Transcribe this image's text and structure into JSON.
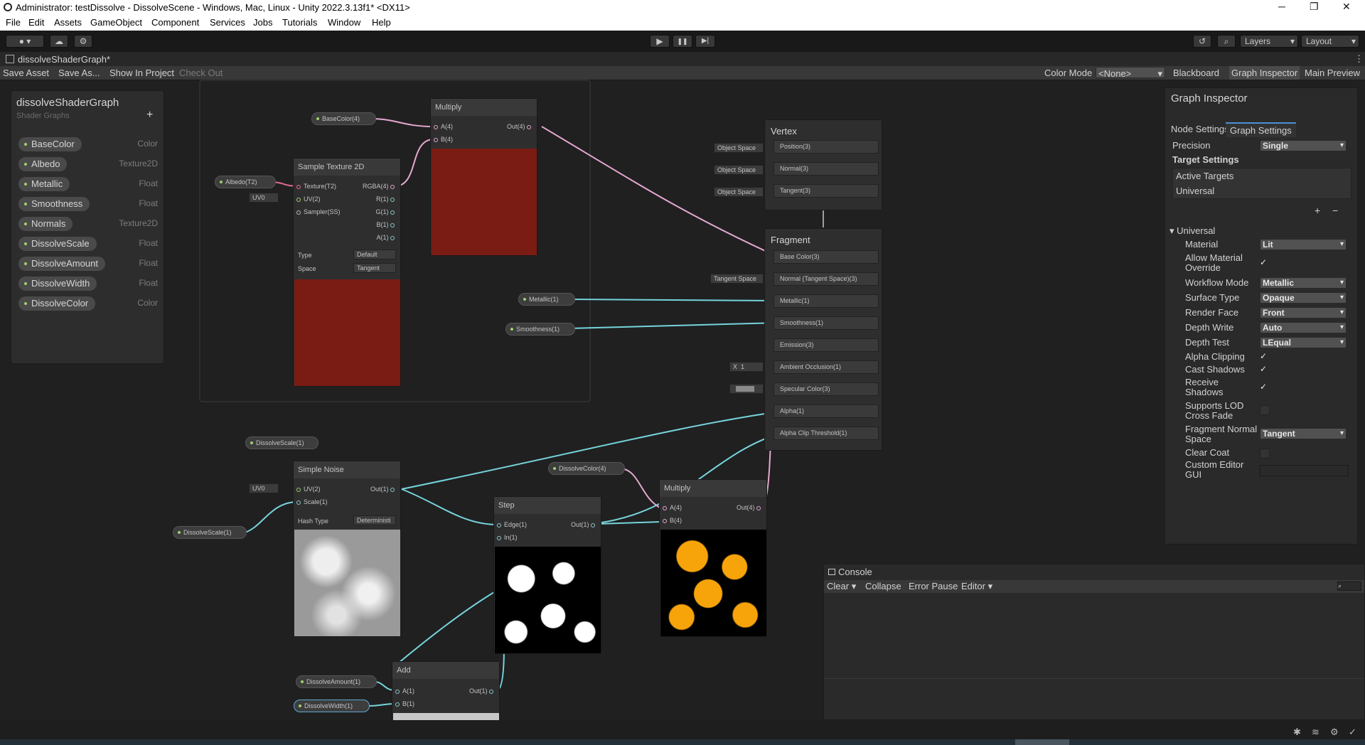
{
  "window": {
    "title": "Administrator: testDissolve - DissolveScene - Windows, Mac, Linux - Unity 2022.3.13f1* <DX11>",
    "controls": [
      "─",
      "❐",
      "✕"
    ]
  },
  "menu": [
    "File",
    "Edit",
    "Assets",
    "GameObject",
    "Component",
    "Services",
    "Jobs",
    "Tutorials",
    "Window",
    "Help"
  ],
  "toolbar": {
    "play_icon": "▶",
    "pause_icon": "❚❚",
    "step_icon": "▶|",
    "layers_label": "Layers",
    "layout_label": "Layout"
  },
  "tab": {
    "label": "dissolveShaderGraph*"
  },
  "graph_toolbar": {
    "save_asset": "Save Asset",
    "save_as": "Save As...",
    "show_in_project": "Show In Project",
    "check_out": "Check Out",
    "color_mode_label": "Color Mode",
    "color_mode_value": "<None>",
    "blackboard": "Blackboard",
    "graph_inspector": "Graph Inspector",
    "main_preview": "Main Preview"
  },
  "blackboard": {
    "title": "dissolveShaderGraph",
    "subtitle": "Shader Graphs",
    "add_label": "+",
    "properties": [
      {
        "name": "BaseColor",
        "type": "Color"
      },
      {
        "name": "Albedo",
        "type": "Texture2D"
      },
      {
        "name": "Metallic",
        "type": "Float"
      },
      {
        "name": "Smoothness",
        "type": "Float"
      },
      {
        "name": "Normals",
        "type": "Texture2D"
      },
      {
        "name": "DissolveScale",
        "type": "Float"
      },
      {
        "name": "DissolveAmount",
        "type": "Float"
      },
      {
        "name": "DissolveWidth",
        "type": "Float"
      },
      {
        "name": "DissolveColor",
        "type": "Color"
      }
    ]
  },
  "nodes": {
    "multiply1": {
      "title": "Multiply",
      "a": "A(4)",
      "b": "B(4)",
      "out": "Out(4)"
    },
    "sample_tex": {
      "title": "Sample Texture 2D",
      "inputs": [
        "Texture(T2)",
        "UV(2)",
        "Sampler(SS)"
      ],
      "outputs": [
        "RGBA(4)",
        "R(1)",
        "G(1)",
        "B(1)",
        "A(1)"
      ],
      "type_label": "Type",
      "type_value": "Default",
      "space_label": "Space",
      "space_value": "Tangent"
    },
    "vertex": {
      "title": "Vertex",
      "slots": [
        "Position(3)",
        "Normal(3)",
        "Tangent(3)"
      ],
      "chip": "Object Space"
    },
    "fragment": {
      "title": "Fragment",
      "slots": [
        "Base Color(3)",
        "Normal (Tangent Space)(3)",
        "Metallic(1)",
        "Smoothness(1)",
        "Emission(3)",
        "Ambient Occlusion(1)",
        "Specular Color(3)",
        "Alpha(1)",
        "Alpha Clip Threshold(1)"
      ],
      "tangent_chip": "Tangent Space",
      "ao_x": "X",
      "ao_value": "1"
    },
    "simple_noise": {
      "title": "Simple Noise",
      "uv": "UV(2)",
      "scale": "Scale(1)",
      "out": "Out(1)",
      "hash_label": "Hash Type",
      "hash_value": "Deterministi"
    },
    "step": {
      "title": "Step",
      "edge": "Edge(1)",
      "in": "In(1)",
      "out": "Out(1)"
    },
    "multiply2": {
      "title": "Multiply",
      "a": "A(4)",
      "b": "B(4)",
      "out": "Out(4)"
    },
    "add": {
      "title": "Add",
      "a": "A(1)",
      "b": "B(1)",
      "out": "Out(1)"
    }
  },
  "graph_props": {
    "basecolor": "BaseColor(4)",
    "albedo": "Albedo(T2)",
    "uv0": "UV0",
    "metallic": "Metallic(1)",
    "smoothness": "Smoothness(1)",
    "dissolvescale_top": "DissolveScale(1)",
    "dissolvescale": "DissolveScale(1)",
    "dissolvecolor": "DissolveColor(4)",
    "dissolveamount": "DissolveAmount(1)",
    "dissolvewidth": "DissolveWidth(1)"
  },
  "inspector": {
    "title": "Graph Inspector",
    "tab_node": "Node Settings",
    "tab_graph": "Graph Settings",
    "precision_label": "Precision",
    "precision_value": "Single",
    "target_settings": "Target Settings",
    "active_targets": "Active Targets",
    "target_universal": "Universal",
    "add": "+",
    "remove": "−",
    "section": "Universal",
    "rows": [
      {
        "label": "Material",
        "value": "Lit"
      },
      {
        "label": "Allow Material Override",
        "value": "✓"
      },
      {
        "label": "Workflow Mode",
        "value": "Metallic"
      },
      {
        "label": "Surface Type",
        "value": "Opaque"
      },
      {
        "label": "Render Face",
        "value": "Front"
      },
      {
        "label": "Depth Write",
        "value": "Auto"
      },
      {
        "label": "Depth Test",
        "value": "LEqual"
      },
      {
        "label": "Alpha Clipping",
        "value": "✓"
      },
      {
        "label": "Cast Shadows",
        "value": "✓"
      },
      {
        "label": "Receive Shadows",
        "value": "✓"
      },
      {
        "label": "Supports LOD Cross Fade",
        "value": ""
      },
      {
        "label": "Fragment Normal Space",
        "value": "Tangent"
      },
      {
        "label": "Clear Coat",
        "value": ""
      },
      {
        "label": "Custom Editor GUI",
        "value": ""
      }
    ]
  },
  "console": {
    "title": "Console",
    "clear": "Clear",
    "collapse": "Collapse",
    "error_pause": "Error Pause",
    "editor": "Editor"
  },
  "colors": {
    "accent": "#4d8fd6",
    "edge_cyan": "#76d4dc",
    "edge_pink": "#e6a8d0",
    "edge_yellow": "#e8e28a",
    "preview_red": "#7a1c14",
    "dissolve_orange": "#f7a40a"
  }
}
